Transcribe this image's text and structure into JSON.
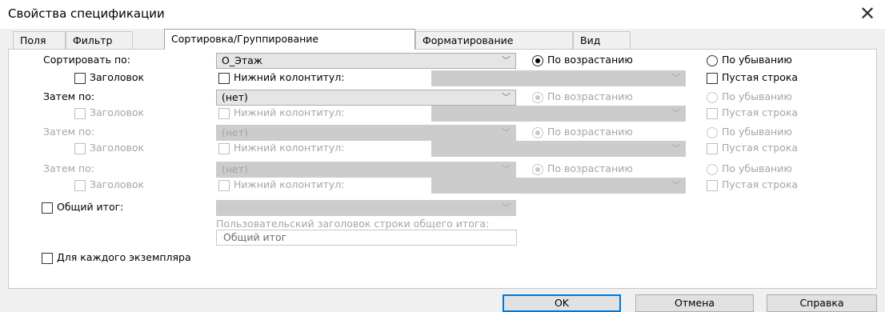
{
  "window": {
    "title": "Свойства спецификации"
  },
  "tabs": [
    "Поля",
    "Фильтр",
    "Сортировка/Группирование",
    "Форматирование",
    "Вид"
  ],
  "rows": [
    {
      "label": "Сортировать по:",
      "field": "О_Этаж",
      "asc": "По возрастанию",
      "desc": "По убыванию",
      "header": "Заголовок",
      "footer": "Нижний колонтитул:",
      "blank": "Пустая строка"
    },
    {
      "label": "Затем по:",
      "field": "(нет)",
      "asc": "По возрастанию",
      "desc": "По убыванию",
      "header": "Заголовок",
      "footer": "Нижний колонтитул:",
      "blank": "Пустая строка"
    },
    {
      "label": "Затем по:",
      "field": "(нет)",
      "asc": "По возрастанию",
      "desc": "По убыванию",
      "header": "Заголовок",
      "footer": "Нижний колонтитул:",
      "blank": "Пустая строка"
    },
    {
      "label": "Затем по:",
      "field": "(нет)",
      "asc": "По возрастанию",
      "desc": "По убыванию",
      "header": "Заголовок",
      "footer": "Нижний колонтитул:",
      "blank": "Пустая строка"
    }
  ],
  "grand_total": {
    "label": "Общий итог:",
    "custom_caption": "Пользовательский заголовок строки общего итога:",
    "value": "Общий итог"
  },
  "each_instance": "Для каждого экземпляра",
  "buttons": {
    "ok": "OK",
    "cancel": "Отмена",
    "help": "Справка"
  },
  "icons": {
    "close": "close-icon",
    "dropdown": "chevron-down-icon"
  },
  "colors": {
    "accent": "#0078d7",
    "disabled_text": "#a5a5a5"
  }
}
